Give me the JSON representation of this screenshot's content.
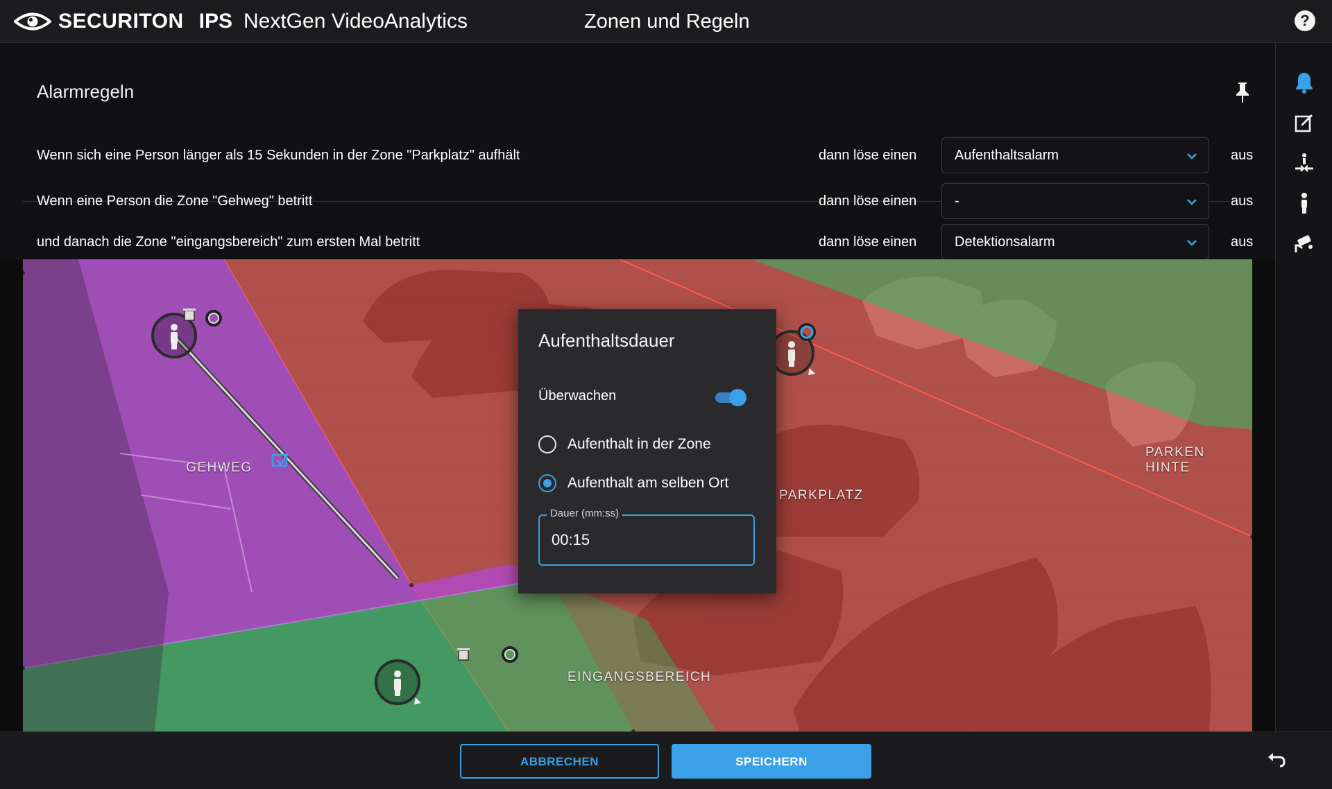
{
  "header": {
    "brand_name": "SECURITON",
    "brand_ips": "IPS",
    "brand_product": "NextGen VideoAnalytics",
    "page_title": "Zonen und Regeln",
    "help_icon_text": "?"
  },
  "rail": {
    "icons": [
      "bell-icon",
      "edit-icon",
      "zone-connect-icon",
      "person-icon",
      "camera-icon"
    ],
    "active_color": "#3aa0e8"
  },
  "rules": {
    "title": "Alarmregeln",
    "rows": [
      {
        "condition": "Wenn sich eine Person länger als 15 Sekunden in der Zone \"Parkplatz\" aufhält",
        "then": "dann löse einen",
        "alarm": "Aufenthaltsalarm",
        "state": "aus"
      },
      {
        "condition": "Wenn eine Person die Zone \"Gehweg\" betritt",
        "then": "dann löse einen",
        "alarm": "-",
        "state": "aus"
      },
      {
        "condition": "und danach die Zone \"eingangsbereich\" zum ersten Mal betritt",
        "then": "dann löse einen",
        "alarm": "Detektionsalarm",
        "state": "aus"
      }
    ]
  },
  "zones": {
    "gehweg": {
      "label": "GEHWEG",
      "color": "#b248d6"
    },
    "parkplatz": {
      "label": "PARKPLATZ",
      "color": "#e0463f"
    },
    "eingangsbereich": {
      "label": "EINGANGSBEREICH",
      "color": "#2dbb67"
    },
    "parken_hinten": {
      "label": "PARKEN HINTE",
      "color": "#2dbb67"
    }
  },
  "dialog": {
    "title": "Aufenthaltsdauer",
    "monitor_label": "Überwachen",
    "monitor_on": true,
    "options": [
      {
        "label": "Aufenthalt in der Zone",
        "selected": false
      },
      {
        "label": "Aufenthalt am selben Ort",
        "selected": true
      }
    ],
    "duration_label": "Dauer (mm:ss)",
    "duration_value": "00:15"
  },
  "footer": {
    "cancel_label": "ABBRECHEN",
    "save_label": "SPEICHERN",
    "accent": "#3aa0e8"
  }
}
